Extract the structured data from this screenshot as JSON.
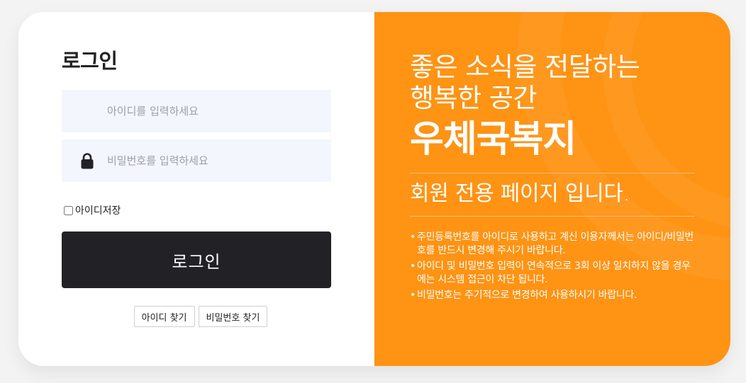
{
  "login": {
    "title": "로그인",
    "id_placeholder": "아이디를 입력하세요",
    "pw_placeholder": "비밀번호를 입력하세요",
    "save_id_label": "아이디저장",
    "save_id_checked": false,
    "login_button": "로그인",
    "find_id_button": "아이디 찾기",
    "find_pw_button": "비밀번호 찾기",
    "icons": [
      "lock-icon"
    ]
  },
  "promo": {
    "headline_line1": "좋은 소식을 전달하는",
    "headline_line2": "행복한 공간",
    "brand": "우체국복지",
    "member_text": "회원 전용 페이지 입니다.",
    "notices": [
      "주민등록번호를 아이디로 사용하고 계신 이용자께서는 아이디/비밀번호를 반드시 변경해 주시기 바랍니다.",
      "아이디 및 비밀번호 입력이 연속적으로 3회 이상 일치하지 않을 경우에는 시스템 접근이 차단 됩니다.",
      "비밀번호는 주기적으로 변경하여 사용하시기 바랍니다."
    ]
  },
  "colors": {
    "page_background": "#f3f3f3",
    "promo_background": "#fe9314",
    "login_button": "#222226",
    "input_background": "#f4f6fd"
  }
}
